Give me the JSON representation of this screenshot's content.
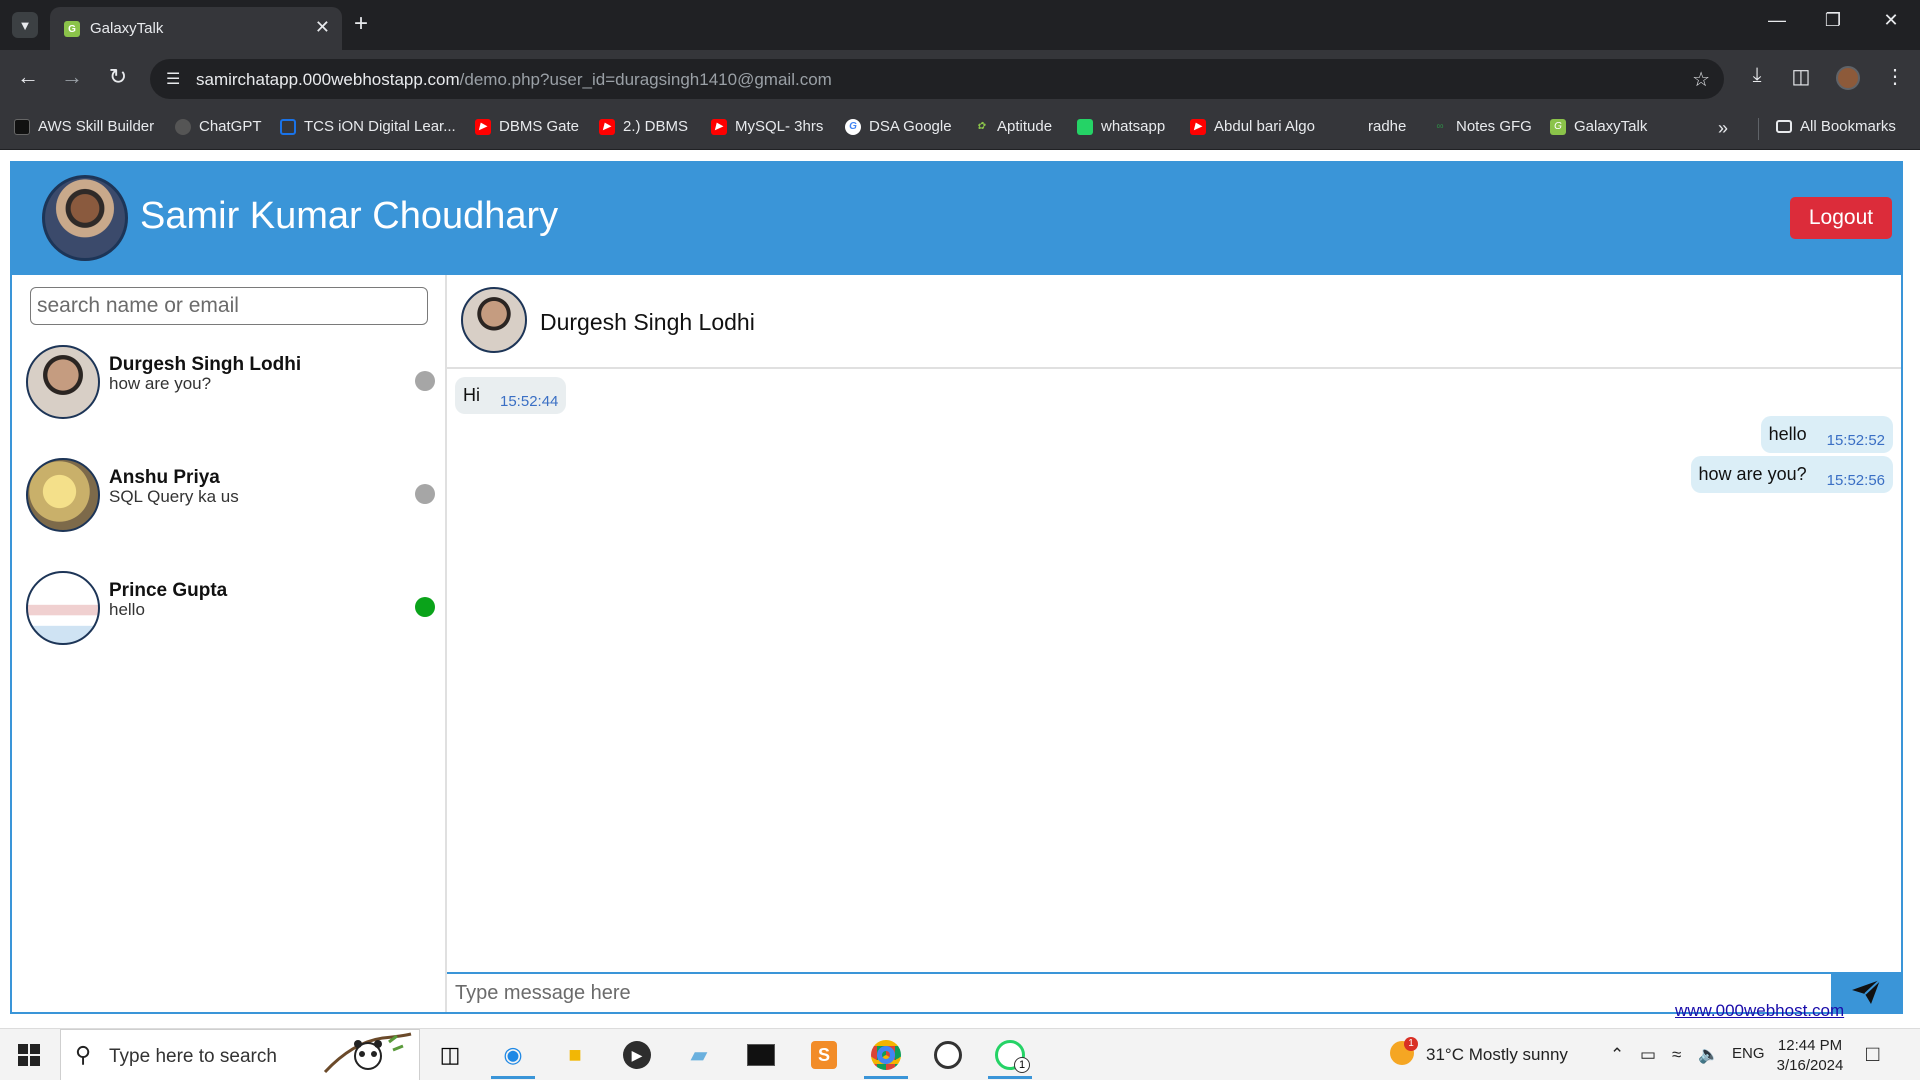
{
  "browser": {
    "tab_title": "GalaxyTalk",
    "url_host": "samirchatapp.000webhostapp.com",
    "url_path": "/demo.php?user_id=duragsingh1410@gmail.com",
    "bookmarks": [
      {
        "label": "AWS Skill Builder",
        "icon": "aws-icon"
      },
      {
        "label": "ChatGPT",
        "icon": "chatgpt-icon"
      },
      {
        "label": "TCS iON Digital Lear...",
        "icon": "tcs-icon"
      },
      {
        "label": "DBMS Gate",
        "icon": "youtube-icon"
      },
      {
        "label": "2.) DBMS",
        "icon": "youtube-icon"
      },
      {
        "label": "MySQL- 3hrs",
        "icon": "youtube-icon"
      },
      {
        "label": "DSA Google",
        "icon": "google-icon"
      },
      {
        "label": "Aptitude",
        "icon": "aptitude-icon"
      },
      {
        "label": "whatsapp",
        "icon": "whatsapp-icon"
      },
      {
        "label": "Abdul bari Algo",
        "icon": "youtube-icon"
      },
      {
        "label": "radhe",
        "icon": ""
      },
      {
        "label": "Notes GFG",
        "icon": "gfg-icon"
      },
      {
        "label": "GalaxyTalk",
        "icon": "galaxytalk-icon"
      }
    ],
    "all_bookmarks_label": "All Bookmarks"
  },
  "app": {
    "user_name": "Samir Kumar Choudhary",
    "logout_label": "Logout",
    "search_placeholder": "search name or email",
    "contacts": [
      {
        "name": "Durgesh Singh Lodhi",
        "last_message": "how are you?",
        "status": "offline",
        "status_color": "#a6a6a6"
      },
      {
        "name": "Anshu Priya",
        "last_message": "SQL Query ka us",
        "status": "offline",
        "status_color": "#a6a6a6"
      },
      {
        "name": "Prince Gupta",
        "last_message": "hello",
        "status": "online",
        "status_color": "#0aa31a"
      }
    ],
    "chat": {
      "partner_name": "Durgesh Singh Lodhi",
      "messages": [
        {
          "direction": "received",
          "text": "Hi",
          "time": "15:52:44"
        },
        {
          "direction": "sent",
          "text": "hello",
          "time": "15:52:52"
        },
        {
          "direction": "sent",
          "text": "how are you?",
          "time": "15:52:56"
        }
      ],
      "input_placeholder": "Type message here"
    },
    "host_link": "www.000webhost.com"
  },
  "taskbar": {
    "search_placeholder": "Type here to search",
    "weather": "31°C  Mostly sunny",
    "weather_badge": "1",
    "language": "ENG",
    "time": "12:44 PM",
    "date": "3/16/2024",
    "whatsapp_badge": "1"
  }
}
